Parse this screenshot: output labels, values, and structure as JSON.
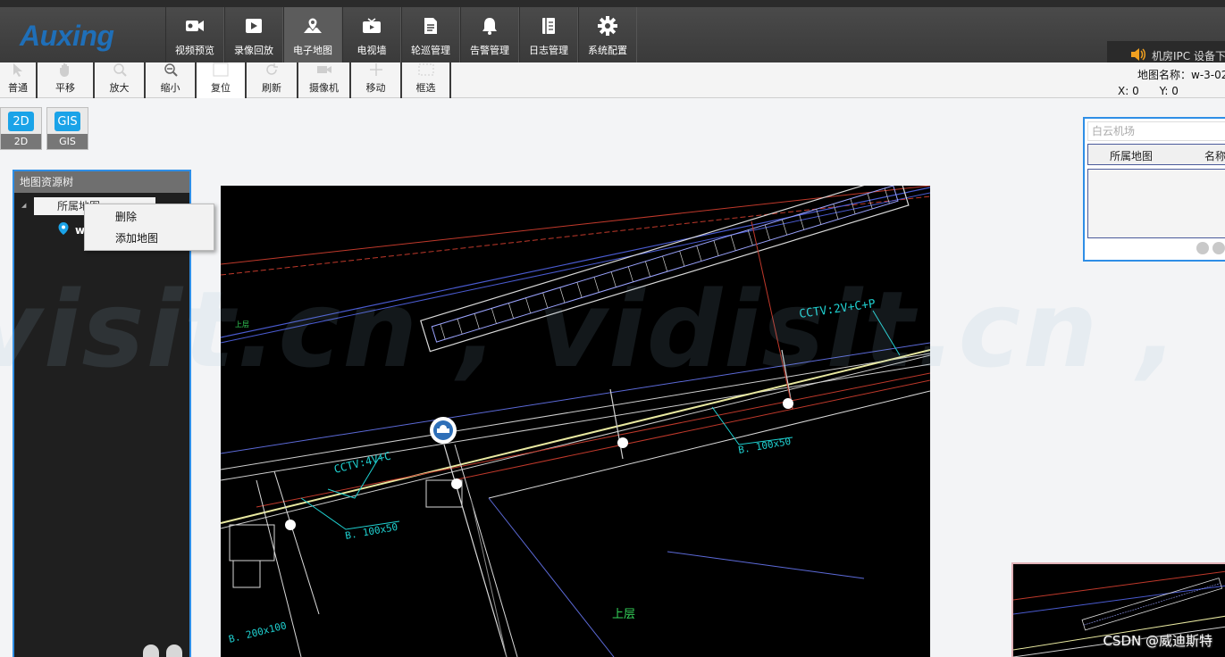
{
  "header": {
    "logo": "Auxing",
    "nav": [
      {
        "label": "视频预览",
        "icon": "video-camera-icon"
      },
      {
        "label": "录像回放",
        "icon": "play-icon"
      },
      {
        "label": "电子地图",
        "icon": "map-pin-icon",
        "active": true
      },
      {
        "label": "电视墙",
        "icon": "tv-icon"
      },
      {
        "label": "轮巡管理",
        "icon": "document-icon"
      },
      {
        "label": "告警管理",
        "icon": "bell-icon"
      },
      {
        "label": "日志管理",
        "icon": "log-book-icon"
      },
      {
        "label": "系统配置",
        "icon": "gear-icon"
      }
    ],
    "right_text": "机房IPC  设备下"
  },
  "toolbar": {
    "tools": [
      "普通",
      "平移",
      "放大",
      "缩小",
      "复位",
      "刷新",
      "摄像机",
      "移动",
      "框选"
    ],
    "active": "复位",
    "map_name": "地图名称：w-3-02",
    "x_label": "X:  0",
    "y_label": "Y:    0"
  },
  "mode": {
    "btn_2d_icon": "2D",
    "btn_2d_label": "2D",
    "btn_gis_icon": "GIS",
    "btn_gis_label": "GIS"
  },
  "tree": {
    "title": "地图资源树",
    "root": "所属地图",
    "child": "w-3-02"
  },
  "context_menu": {
    "delete": "删除",
    "add_map": "添加地图"
  },
  "map": {
    "labels": {
      "cctv1": "CCTV:2V+C+P",
      "cctv2": "CCTV:4V+C",
      "bracket1": "B. 100x50",
      "bracket2": "B. 100x50",
      "bracket3": "B. 200x100",
      "upper": "上层",
      "upper2": "上层"
    }
  },
  "search": {
    "placeholder": "白云机场",
    "col_map": "所属地图",
    "col_name": "名称"
  },
  "watermark": "visit.cn , vidisit.cn , vidisit",
  "csdn": "CSDN @威迪斯特"
}
